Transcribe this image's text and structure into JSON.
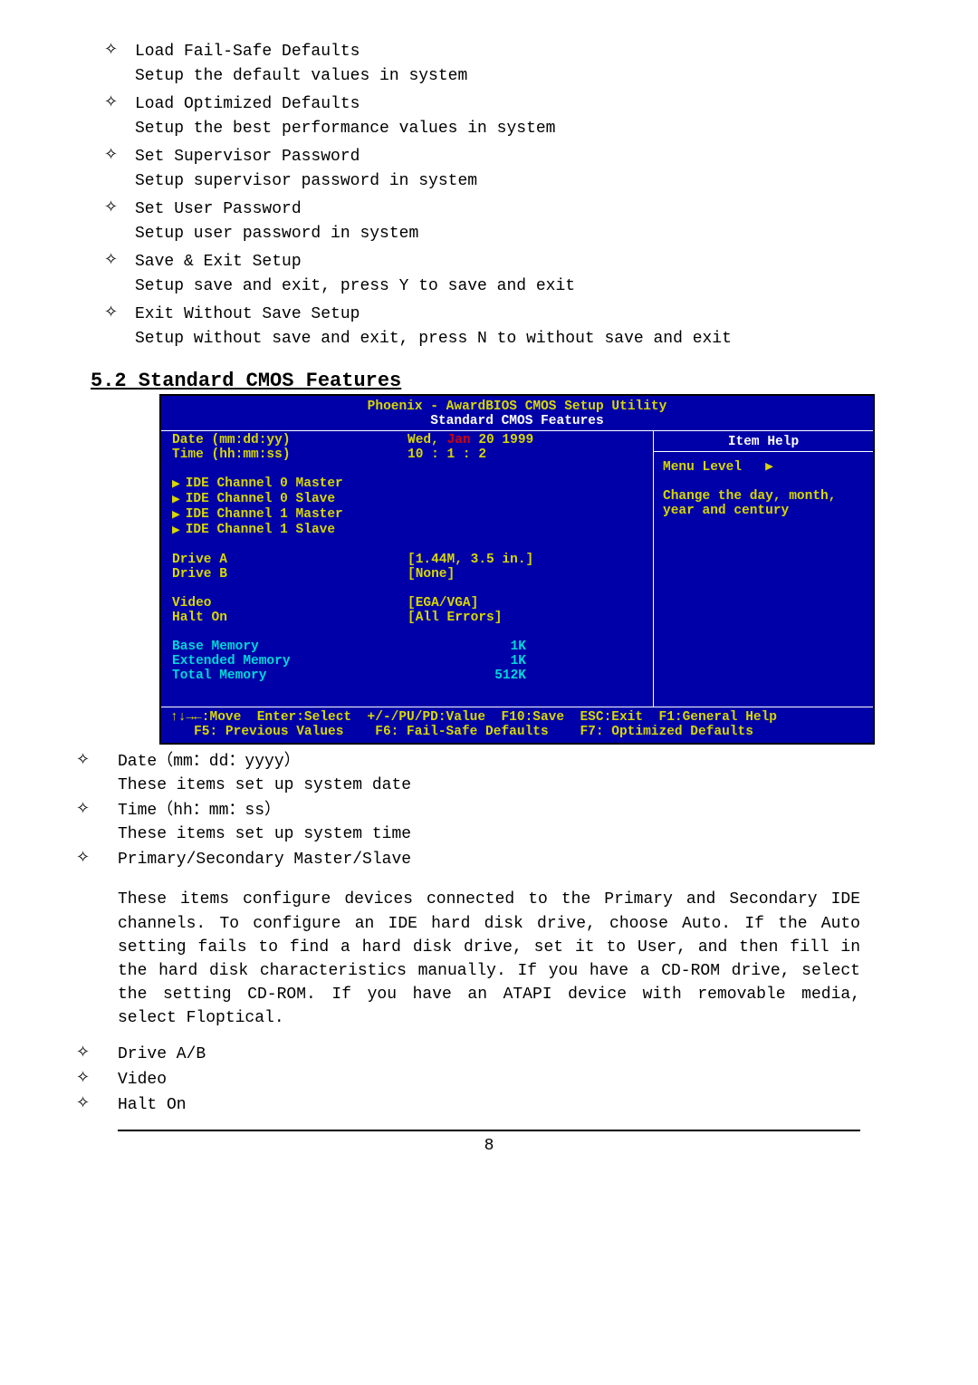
{
  "top_items": [
    {
      "title": "Load Fail-Safe Defaults",
      "desc": "Setup the default values in system"
    },
    {
      "title": "Load Optimized Defaults",
      "desc": "Setup the best performance values in system"
    },
    {
      "title": "Set Supervisor Password",
      "desc": "Setup supervisor password in system"
    },
    {
      "title": "Set User Password",
      "desc": "Setup user password in system"
    },
    {
      "title": "Save & Exit Setup",
      "desc": "Setup save and exit, press Y to save and exit"
    },
    {
      "title": "Exit Without Save Setup",
      "desc": "Setup without save and exit, press N to without save and exit"
    }
  ],
  "heading": "5.2 Standard CMOS Features",
  "bios": {
    "title1": "Phoenix - AwardBIOS CMOS Setup Utility",
    "title2": "Standard CMOS Features",
    "date_label": "Date (mm:dd:yy)",
    "date_val_prefix": "Wed, ",
    "date_val_red": "Jan",
    "date_val_suffix": " 20 1999",
    "time_label": "Time (hh:mm:ss)",
    "time_val": "10 :  1 :  2",
    "ide0m": "IDE Channel 0 Master",
    "ide0s": "IDE Channel 0 Slave",
    "ide1m": "IDE Channel 1 Master",
    "ide1s": "IDE Channel 1 Slave",
    "driveA_label": "Drive A",
    "driveA_val": "[1.44M, 3.5 in.]",
    "driveB_label": "Drive B",
    "driveB_val": "[None]",
    "video_label": "Video",
    "video_val": "[EGA/VGA]",
    "halt_label": "Halt On",
    "halt_val": "[All Errors]",
    "basemem_label": "Base Memory",
    "basemem_val": "1K",
    "extmem_label": "Extended Memory",
    "extmem_val": "1K",
    "totalmem_label": "Total Memory",
    "totalmem_val": "512K",
    "help_title": "Item Help",
    "menu_level": "Menu Level",
    "help_text": "Change the day, month, year and century",
    "footer1": "↑↓→←:Move  Enter:Select  +/-/PU/PD:Value  F10:Save  ESC:Exit  F1:General Help",
    "footer2": "   F5: Previous Values    F6: Fail-Safe Defaults    F7: Optimized Defaults"
  },
  "post_items": {
    "p1_title": "Date（mm：dd：yyyy）",
    "p1_desc": "These items set up system date",
    "p2_title": "Time（hh：mm：ss）",
    "p2_desc": "These items set up system time",
    "p3_title": "Primary/Secondary Master/Slave",
    "p3_desc": "These items configure devices connected to the Primary and Secondary IDE channels. To configure an IDE hard disk drive, choose Auto. If the Auto setting fails to find a hard disk drive, set it to User, and then fill in the hard disk characteristics manually. If you have a CD-ROM drive, select the setting CD-ROM. If you have an ATAPI device with removable media, select Floptical.",
    "p4_title": "Drive  A/B",
    "p5_title": "Video",
    "p6_title": "Halt  On"
  },
  "page_num": "8",
  "diamond": "✧"
}
